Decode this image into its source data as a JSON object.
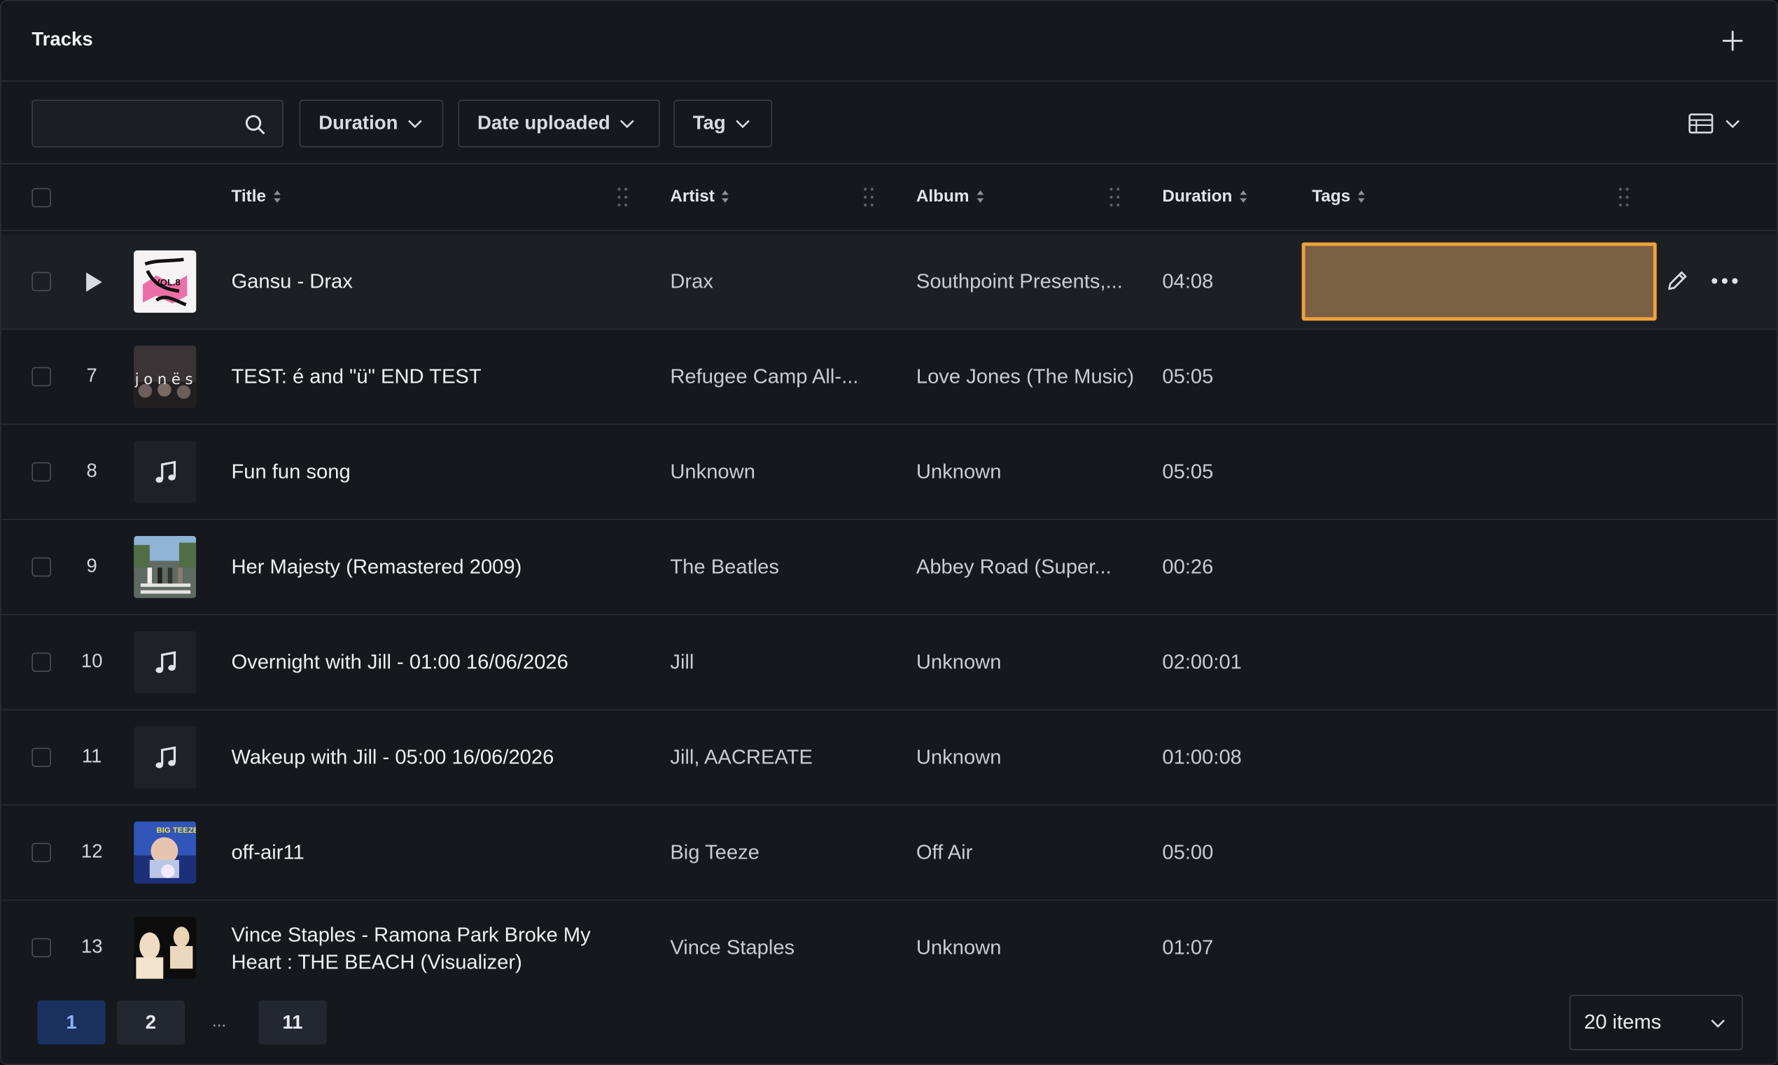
{
  "panel": {
    "title": "Tracks",
    "add_icon": "plus-icon"
  },
  "toolbar": {
    "search_placeholder": "",
    "filters": [
      "Duration",
      "Date uploaded",
      "Tag"
    ],
    "view_icon": "table-view-icon"
  },
  "columns": [
    "Title",
    "Artist",
    "Album",
    "Duration",
    "Tags"
  ],
  "rows": [
    {
      "num": "",
      "title": "Gansu - Drax",
      "artist": "Drax",
      "album": "Southpoint Presents,...",
      "duration": "04:08",
      "art": "pink-cover",
      "playing": true
    },
    {
      "num": "7",
      "title": "TEST: é and \"ü\" END TEST",
      "artist": "Refugee Camp All-...",
      "album": "Love Jones (The Music)",
      "duration": "05:05",
      "art": "jones-cover"
    },
    {
      "num": "8",
      "title": "Fun fun song",
      "artist": "Unknown",
      "album": "Unknown",
      "duration": "05:05",
      "art": "music-note"
    },
    {
      "num": "9",
      "title": "Her Majesty (Remastered 2009)",
      "artist": "The Beatles",
      "album": "Abbey Road (Super...",
      "duration": "00:26",
      "art": "abbey-road-cover"
    },
    {
      "num": "10",
      "title": "Overnight with Jill - 01:00 16/06/2026",
      "artist": "Jill",
      "album": "Unknown",
      "duration": "02:00:01",
      "art": "music-note"
    },
    {
      "num": "11",
      "title": "Wakeup with Jill - 05:00 16/06/2026",
      "artist": "Jill, AACREATE",
      "album": "Unknown",
      "duration": "01:00:08",
      "art": "music-note"
    },
    {
      "num": "12",
      "title": "off-air11",
      "artist": "Big Teeze",
      "album": "Off Air",
      "duration": "05:00",
      "art": "big-teeze-cover"
    },
    {
      "num": "13",
      "title_line1": "Vince Staples - Ramona Park Broke My",
      "title_line2": "Heart : THE BEACH (Visualizer)",
      "artist": "Vince Staples",
      "album": "Unknown",
      "duration": "01:07",
      "art": "vince-cover"
    }
  ],
  "pagination": {
    "pages": [
      "1",
      "2",
      "11"
    ],
    "ellipsis": "...",
    "active": "1",
    "per_page": "20 items"
  },
  "colors": {
    "accent_highlight": "#f0a23a",
    "active_page": "#1a3160"
  }
}
